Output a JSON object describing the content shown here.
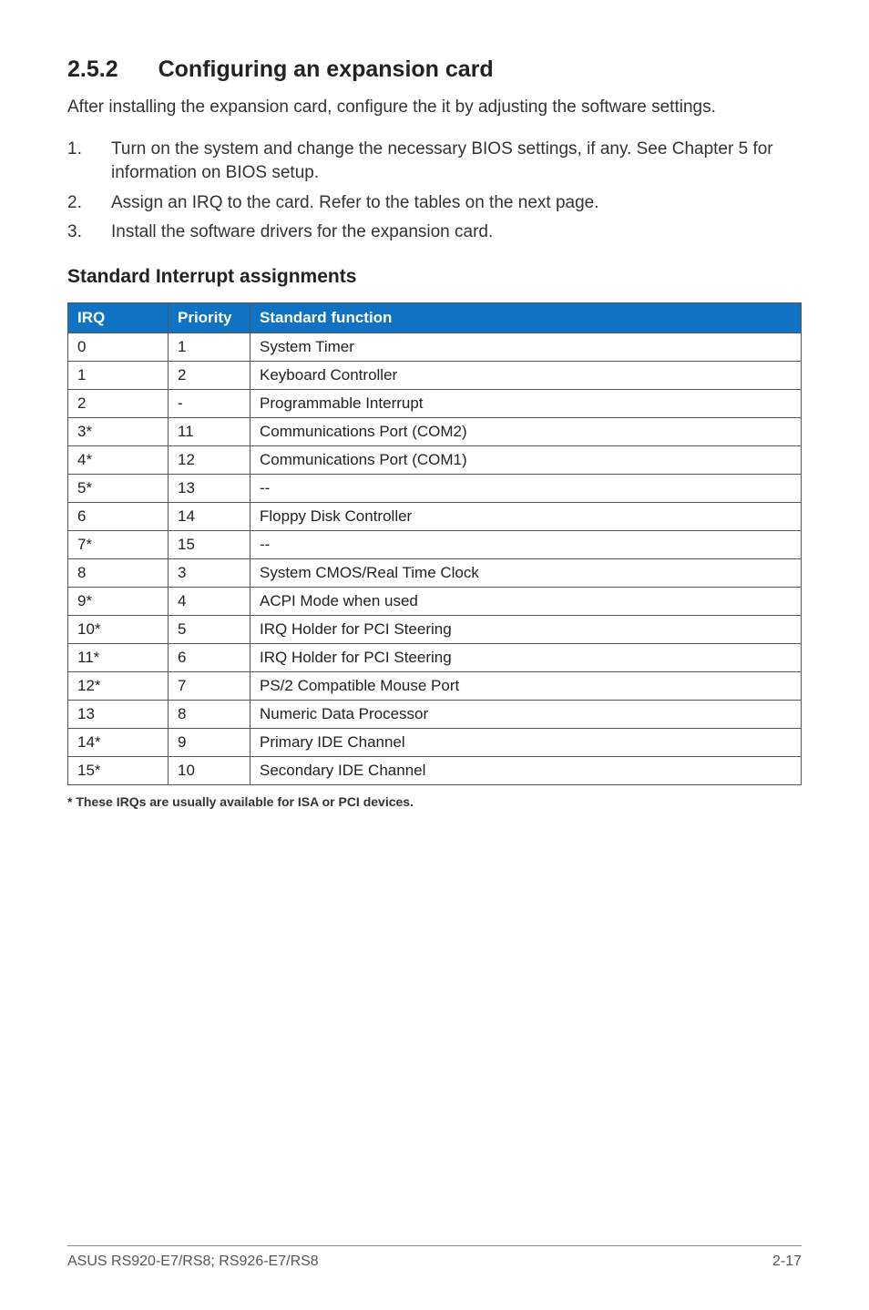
{
  "section": {
    "number": "2.5.2",
    "title": "Configuring an expansion card"
  },
  "intro": "After installing the expansion card, configure the it by adjusting the software settings.",
  "steps": [
    {
      "num": "1.",
      "text": "Turn on the system and change the necessary BIOS settings, if any. See Chapter 5 for information on BIOS setup."
    },
    {
      "num": "2.",
      "text": "Assign an IRQ to the card. Refer to the tables on the next page."
    },
    {
      "num": "3.",
      "text": "Install the software drivers for the expansion card."
    }
  ],
  "table_heading": "Standard Interrupt assignments",
  "columns": {
    "irq": "IRQ",
    "priority": "Priority",
    "func": "Standard function"
  },
  "rows": [
    {
      "irq": "0",
      "priority": "1",
      "func": "System Timer"
    },
    {
      "irq": "1",
      "priority": "2",
      "func": "Keyboard Controller"
    },
    {
      "irq": "2",
      "priority": "-",
      "func": "Programmable Interrupt"
    },
    {
      "irq": "3*",
      "priority": "11",
      "func": "Communications Port (COM2)"
    },
    {
      "irq": "4*",
      "priority": "12",
      "func": "Communications Port (COM1)"
    },
    {
      "irq": "5*",
      "priority": "13",
      "func": "--"
    },
    {
      "irq": "6",
      "priority": "14",
      "func": "Floppy Disk Controller"
    },
    {
      "irq": "7*",
      "priority": "15",
      "func": "--"
    },
    {
      "irq": "8",
      "priority": "3",
      "func": "System CMOS/Real Time Clock"
    },
    {
      "irq": "9*",
      "priority": "4",
      "func": "ACPI Mode when used"
    },
    {
      "irq": "10*",
      "priority": "5",
      "func": "IRQ Holder for PCI Steering"
    },
    {
      "irq": "11*",
      "priority": "6",
      "func": "IRQ Holder for PCI Steering"
    },
    {
      "irq": "12*",
      "priority": "7",
      "func": "PS/2 Compatible Mouse Port"
    },
    {
      "irq": "13",
      "priority": "8",
      "func": "Numeric Data Processor"
    },
    {
      "irq": "14*",
      "priority": "9",
      "func": "Primary IDE Channel"
    },
    {
      "irq": "15*",
      "priority": "10",
      "func": "Secondary IDE Channel"
    }
  ],
  "footnote": "* These IRQs are usually available for ISA or PCI devices.",
  "footer": {
    "left": "ASUS RS920-E7/RS8; RS926-E7/RS8",
    "right": "2-17"
  }
}
